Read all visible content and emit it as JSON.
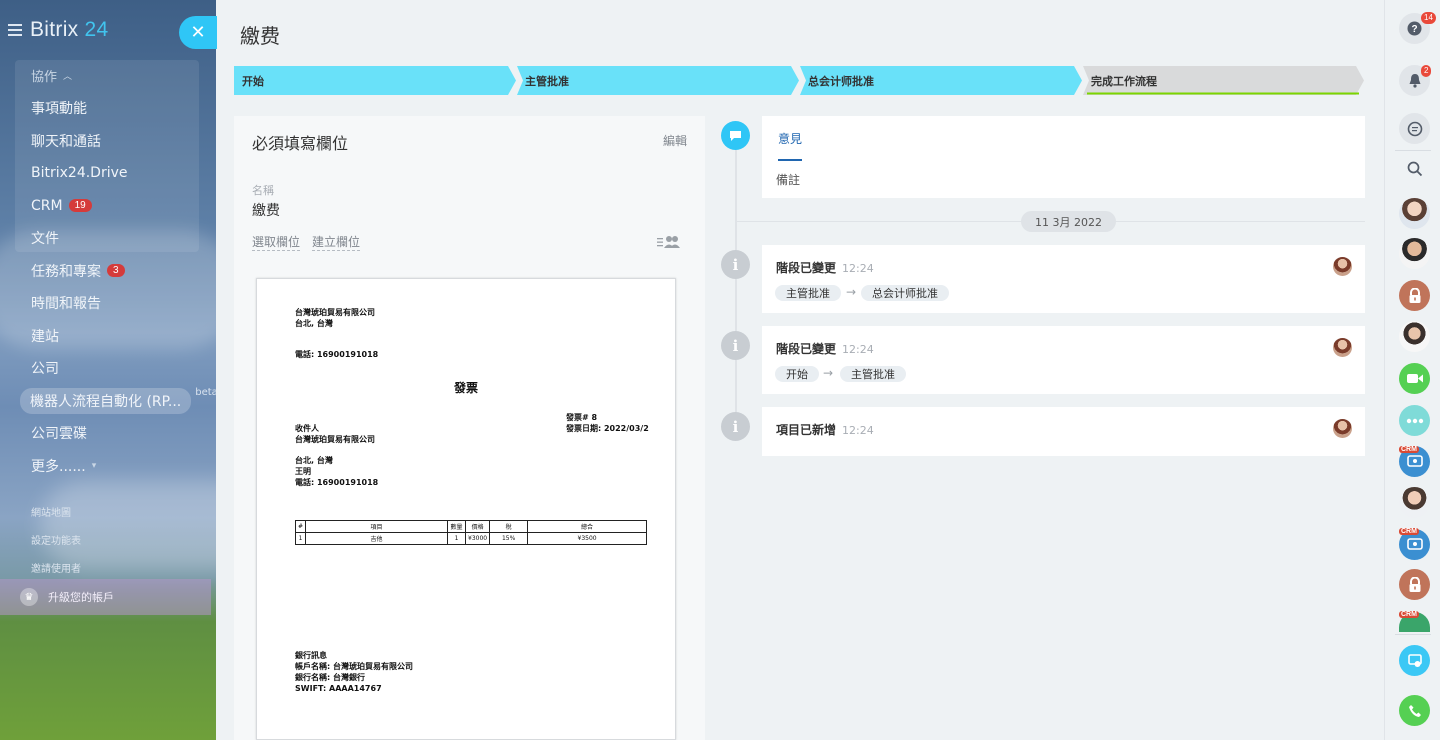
{
  "sidebar": {
    "logo_text": "Bitrix",
    "logo_num": "24",
    "group_header": "協作",
    "items": [
      {
        "label": "事項動能"
      },
      {
        "label": "聊天和通話"
      },
      {
        "label": "Bitrix24.Drive"
      },
      {
        "label": "CRM",
        "badge": "19"
      },
      {
        "label": "文件"
      },
      {
        "label": "任務和專案",
        "badge": "3"
      },
      {
        "label": "時間和報告"
      },
      {
        "label": "建站"
      },
      {
        "label": "公司"
      },
      {
        "label": "機器人流程自動化 (RP...",
        "beta": "beta"
      },
      {
        "label": "公司雲碟"
      },
      {
        "label": "更多......"
      }
    ],
    "small_links": [
      "網站地圖",
      "設定功能表",
      "邀請使用者"
    ],
    "upgrade_label": "升級您的帳戶"
  },
  "header": {
    "close_symbol": "✕",
    "title": "繳费"
  },
  "stages": [
    {
      "label": "开始",
      "color": "#69e1f9"
    },
    {
      "label": "主管批准",
      "color": "#69e1f9"
    },
    {
      "label": "总会计师批准",
      "color": "#69e1f9"
    },
    {
      "label": "完成工作流程",
      "color": "#d9dadb",
      "underline_color": "#7bd500"
    }
  ],
  "form": {
    "required_title": "必須填寫欄位",
    "edit_label": "編輯",
    "name_label": "名稱",
    "name_value": "繳费",
    "select_field_label": "選取欄位",
    "create_field_label": "建立欄位"
  },
  "document": {
    "company": "台灣琥珀貿易有限公司",
    "company_city": "台北, 台灣",
    "phone": "電話: 16900191018",
    "title": "發票",
    "invoice_no": "發票# 8",
    "invoice_date": "發票日期: 2022/03/2",
    "recipient_label": "收件人",
    "recipient_company": "台灣琥珀貿易有限公司",
    "recipient_city": "台北, 台灣",
    "recipient_name": "王明",
    "recipient_phone": "電話: 16900191018",
    "table_headers": [
      "#",
      "項目",
      "數量",
      "價格",
      "稅",
      "總合"
    ],
    "table_rows": [
      [
        "1",
        "吉他",
        "1",
        "¥3000",
        "15%",
        "¥3500"
      ]
    ],
    "bank_label": "銀行訊息",
    "bank_account": "帳戶名稱: 台灣琥珀貿易有限公司",
    "bank_name": "銀行名稱: 台灣銀行",
    "swift": "SWIFT: AAAA14767"
  },
  "timeline": {
    "comment_tab": "意見",
    "note_label": "備註",
    "date": "11 3月 2022",
    "events": [
      {
        "title": "階段已變更",
        "time": "12:24",
        "from": "主管批准",
        "to": "总会计师批准"
      },
      {
        "title": "階段已變更",
        "time": "12:24",
        "from": "开始",
        "to": "主管批准"
      },
      {
        "title": "項目已新增",
        "time": "12:24"
      }
    ]
  },
  "right_panel": {
    "help_badge": "14",
    "notif_badge": "2",
    "crm_tag": "CRM"
  }
}
